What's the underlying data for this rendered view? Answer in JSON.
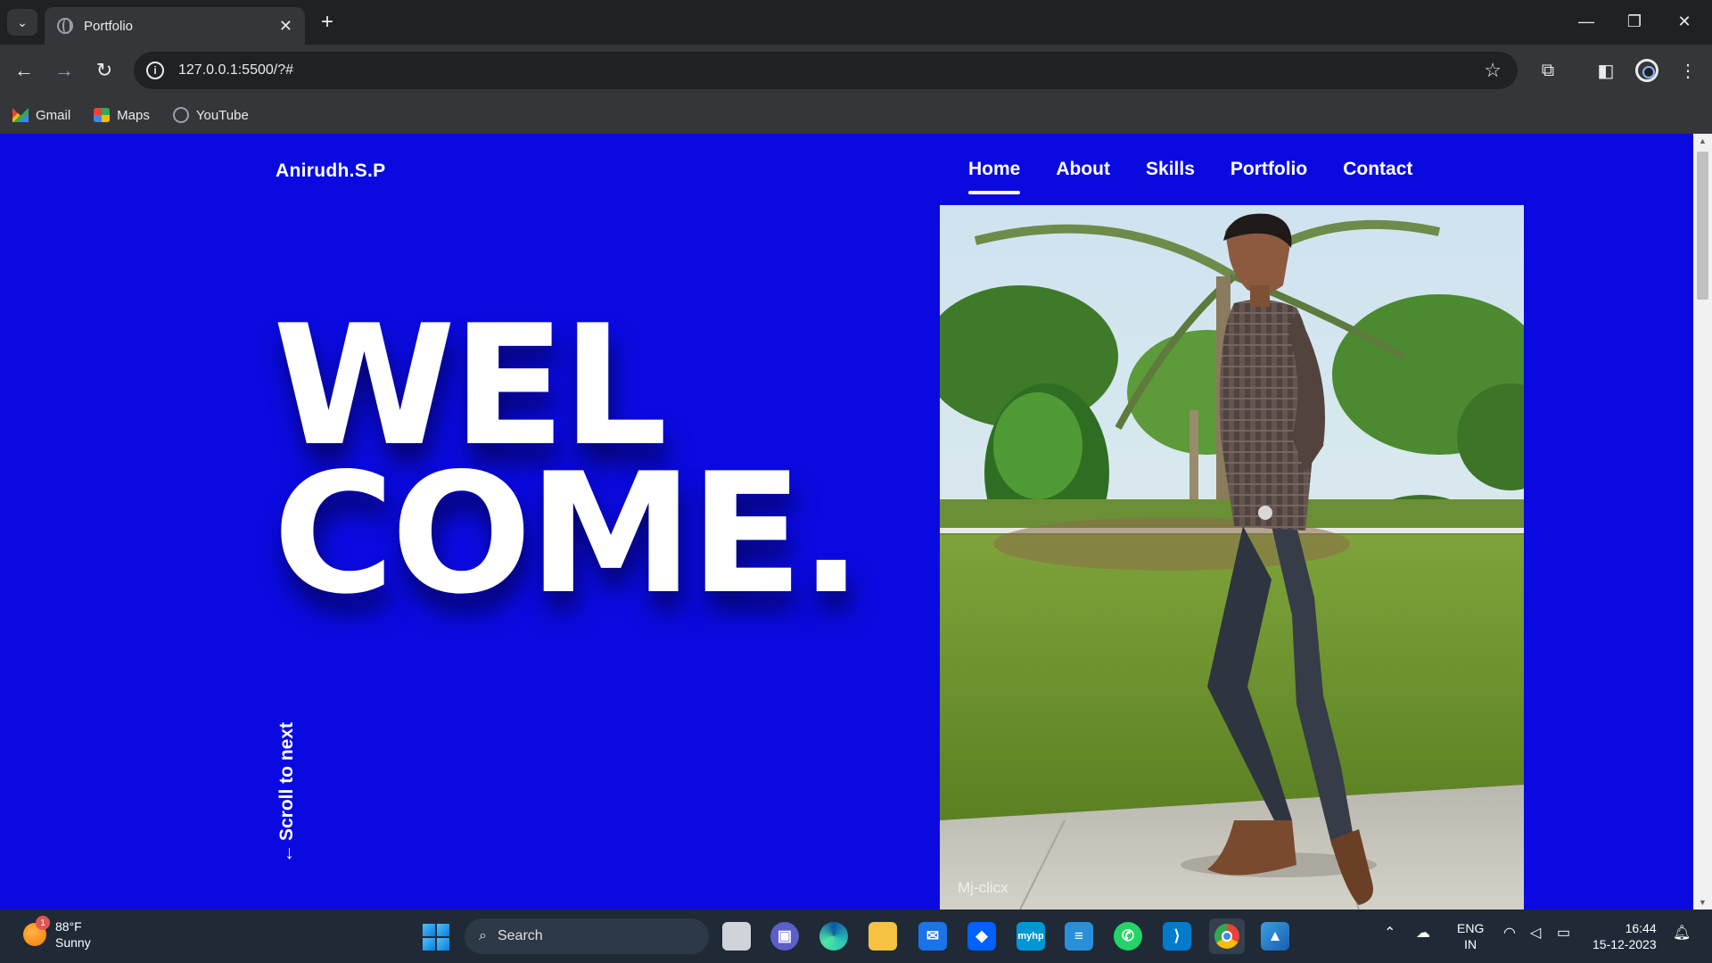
{
  "browser": {
    "tab_title": "Portfolio",
    "tab_close": "✕",
    "new_tab": "+",
    "url": "127.0.0.1:5500/?#",
    "window_controls": {
      "minimize": "—",
      "restore": "❐",
      "close": "✕"
    },
    "bookmarks": [
      {
        "label": "Gmail",
        "icon": "gmail-icon"
      },
      {
        "label": "Maps",
        "icon": "maps-icon"
      },
      {
        "label": "YouTube",
        "icon": "globe-icon"
      }
    ]
  },
  "page": {
    "brand": "Anirudh.S.P",
    "nav": [
      {
        "label": "Home",
        "active": true
      },
      {
        "label": "About",
        "active": false
      },
      {
        "label": "Skills",
        "active": false
      },
      {
        "label": "Portfolio",
        "active": false
      },
      {
        "label": "Contact",
        "active": false
      }
    ],
    "hero_line1": "WEL",
    "hero_line2": "COME.",
    "scroll_hint": "Scroll to next",
    "scroll_arrow": "←",
    "photo_watermark": "Mj-clicx",
    "colors": {
      "background": "#0a0ae0",
      "text": "#ffffff"
    }
  },
  "taskbar": {
    "weather_temp": "88°F",
    "weather_desc": "Sunny",
    "weather_badge": "1",
    "search_placeholder": "Search",
    "language": "ENG",
    "region": "IN",
    "time": "16:44",
    "date": "15-12-2023",
    "apps": [
      "task-view",
      "teams",
      "edge",
      "file-explorer",
      "mail",
      "dropbox",
      "myhp",
      "notepad",
      "whatsapp",
      "vscode",
      "chrome",
      "photos"
    ],
    "myhp_label": "myhp"
  }
}
